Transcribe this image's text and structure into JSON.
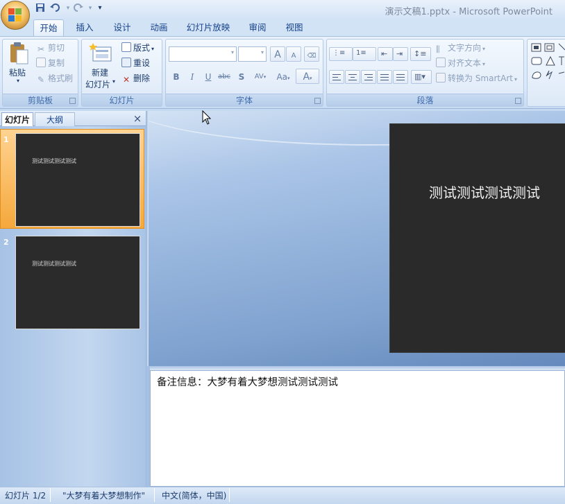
{
  "window": {
    "title": "演示文稿1.pptx - Microsoft PowerPoint"
  },
  "quick_access": [
    {
      "icon": "save-icon"
    },
    {
      "icon": "undo-icon"
    },
    {
      "icon": "redo-icon"
    },
    {
      "icon": "customize-qat-icon"
    }
  ],
  "tabs": [
    "开始",
    "插入",
    "设计",
    "动画",
    "幻灯片放映",
    "审阅",
    "视图"
  ],
  "ribbon": {
    "clipboard": {
      "label": "剪贴板",
      "paste": "粘贴",
      "cut": "剪切",
      "copy": "复制",
      "format_painter": "格式刷"
    },
    "slides": {
      "label": "幻灯片",
      "new_slide_line1": "新建",
      "new_slide_line2": "幻灯片",
      "layout": "版式",
      "reset": "重设",
      "delete": "删除"
    },
    "font": {
      "label": "字体",
      "font_name": "",
      "font_size": "",
      "grow": "A",
      "shrink": "A",
      "bold": "B",
      "italic": "I",
      "underline": "U",
      "strike": "abc",
      "shadow": "S",
      "spacing": "AV",
      "case": "Aa",
      "color": "A"
    },
    "paragraph": {
      "label": "段落",
      "text_direction": "文字方向",
      "align_text": "对齐文本",
      "convert_smartart": "转换为 SmartArt"
    }
  },
  "slide_pane": {
    "tab_slides": "幻灯片",
    "tab_outline": "大纲",
    "close": "×",
    "thumbnails": [
      {
        "number": "1",
        "text": "测试测试测试测试",
        "selected": true
      },
      {
        "number": "2",
        "text": "测试测试测试测试",
        "selected": false
      }
    ]
  },
  "slide": {
    "title": "测试测试测试测试"
  },
  "notes": {
    "text": "备注信息：大梦有着大梦想测试测试测试"
  },
  "status": {
    "slide_index": "幻灯片 1/2",
    "theme": "\"大梦有着大梦想制作\"",
    "language": "中文(简体，中国)"
  },
  "colors": {
    "slide_bg": "#2a2a2a",
    "selected_thumb": "#f5a83c",
    "ribbon_bg": "#dbe8f7",
    "app_bg": "#7fa2cf"
  }
}
